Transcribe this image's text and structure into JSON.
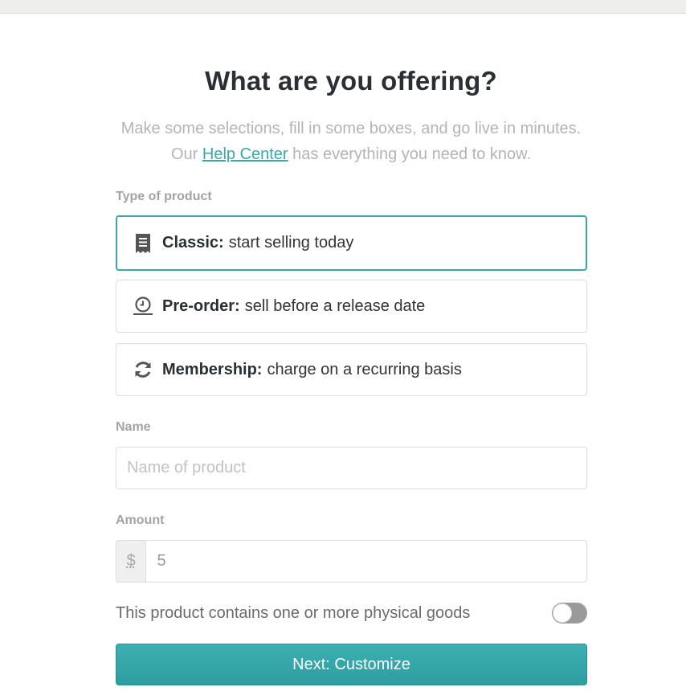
{
  "header": {
    "title": "What are you offering?",
    "subtitle_before": "Make some selections, fill in some boxes, and go live in minutes. Our ",
    "help_link": "Help Center",
    "subtitle_after": " has everything you need to know."
  },
  "product_type": {
    "label": "Type of product",
    "selected": "classic",
    "options": [
      {
        "id": "classic",
        "icon": "receipt-icon",
        "name": "Classic:",
        "description": "start selling today"
      },
      {
        "id": "preorder",
        "icon": "clock-icon",
        "name": "Pre-order:",
        "description": "sell before a release date"
      },
      {
        "id": "membership",
        "icon": "refresh-icon",
        "name": "Membership:",
        "description": "charge on a recurring basis"
      }
    ]
  },
  "name_field": {
    "label": "Name",
    "placeholder": "Name of product",
    "value": ""
  },
  "amount_field": {
    "label": "Amount",
    "currency": "$",
    "value": "5"
  },
  "physical": {
    "label": "This product contains one or more physical goods",
    "enabled": false
  },
  "next_button": {
    "label": "Next: Customize"
  },
  "colors": {
    "accent": "#3aa7a9",
    "toggle_off": "#9a9a9a"
  }
}
